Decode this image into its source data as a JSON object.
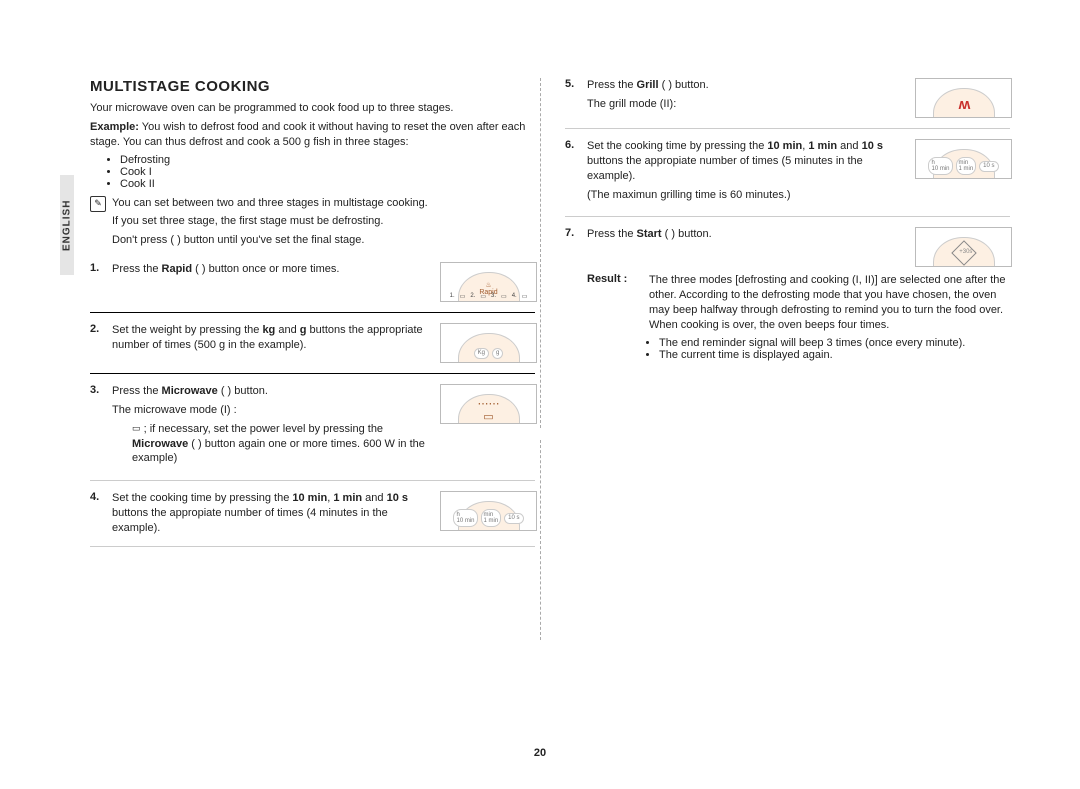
{
  "language_tab": "ENGLISH",
  "page_number": "20",
  "title": "MULTISTAGE COOKING",
  "intro": "Your microwave oven can be programmed to cook food up to three stages.",
  "example_label": "Example:",
  "example_text": "You wish to defrost food and cook it without having to reset the oven after each stage. You can thus defrost and cook a 500 g fish in three stages:",
  "stage_list": [
    "Defrosting",
    "Cook I",
    "Cook II"
  ],
  "note_lines": [
    "You can set between two and three stages in multistage cooking.",
    "If you set three stage, the first stage must be defrosting.",
    "Don't press (     ) button until you've set the final stage."
  ],
  "step1": {
    "num": "1.",
    "text_a": "Press the ",
    "bold": "Rapid",
    "text_b": " (      ) button once or more times.",
    "illus_label": "Rapid",
    "illus_bottom": [
      "1.",
      "2.",
      "3.",
      "4."
    ]
  },
  "step2": {
    "num": "2.",
    "text_a": "Set the weight by pressing the ",
    "bold1": "kg",
    "text_mid": " and ",
    "bold2": "g",
    "text_b": " buttons the appropriate number of times (500 g in the example).",
    "illus_btns": [
      "Kg",
      "g"
    ]
  },
  "step3": {
    "num": "3.",
    "line1_a": "Press the ",
    "line1_bold": "Microwave",
    "line1_b": " (      ) button.",
    "line2": "The microwave mode (I) :",
    "sub_a": "; if necessary, set the power level by pressing the ",
    "sub_bold": "Microwave",
    "sub_b": " (      ) button again one or more times. 600 W in the example)"
  },
  "step4": {
    "num": "4.",
    "text_a": "Set the cooking time by pressing the ",
    "bold1": "10 min",
    "mid1": ", ",
    "bold2": "1 min",
    "mid2": " and ",
    "bold3": "10 s",
    "text_b": " buttons the appropiate number of times (4 minutes in the example).",
    "illus_btns": [
      "h\n10 min",
      "min\n1 min",
      "10 s"
    ]
  },
  "step5": {
    "num": "5.",
    "text_a": "Press the ",
    "bold": "Grill",
    "text_b": " (     ) button.",
    "line2": "The grill mode (II):"
  },
  "step6": {
    "num": "6.",
    "text_a": "Set the cooking time by pressing the ",
    "bold1": "10 min",
    "mid1": ", ",
    "bold2": "1 min",
    "mid2": " and ",
    "bold3": "10 s",
    "text_b": " buttons the appropiate number of times (5 minutes in the example).",
    "note": "(The maximun grilling time is 60 minutes.)",
    "illus_btns": [
      "h\n10 min",
      "min\n1 min",
      "10 s"
    ]
  },
  "step7": {
    "num": "7.",
    "text_a": "Press the ",
    "bold": "Start",
    "text_b": " (     ) button.",
    "illus_label": "+30s"
  },
  "result_label": "Result :",
  "result_text": "The three modes [defrosting and cooking (I, II)] are selected one after the other. According to the defrosting mode that you have chosen, the oven may beep halfway through defrosting to remind you to turn the food over. When cooking is over, the oven beeps four times.",
  "result_bullets": [
    "The end reminder signal will beep 3 times (once every minute).",
    "The current time is displayed again."
  ]
}
